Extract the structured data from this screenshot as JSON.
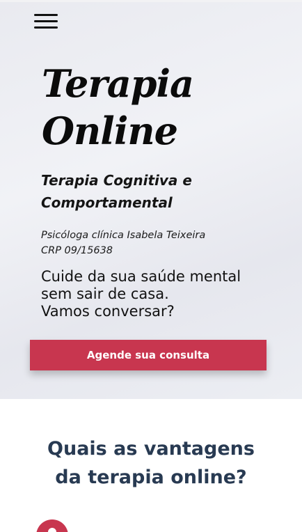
{
  "hero": {
    "title_line1": "Terapia",
    "title_line2": "Online",
    "subtitle_line1": "Terapia Cognitiva e",
    "subtitle_line2": "Comportamental",
    "psychologist": "Psicóloga clínica Isabela Teixeira",
    "crp": "CRP 09/15638",
    "tagline_line1": "Cuide da sua saúde mental",
    "tagline_line2": "sem sair de casa.",
    "tagline_line3": "Vamos conversar?",
    "cta_label": "Agende sua consulta"
  },
  "advantages": {
    "title_line1": "Quais as vantagens",
    "title_line2": "da terapia online?"
  },
  "colors": {
    "accent": "#c8364f",
    "heading": "#283a52",
    "hero_bg": "#eceef3"
  },
  "icons": {
    "menu": "hamburger-menu-icon",
    "advantage": "circle-icon"
  }
}
